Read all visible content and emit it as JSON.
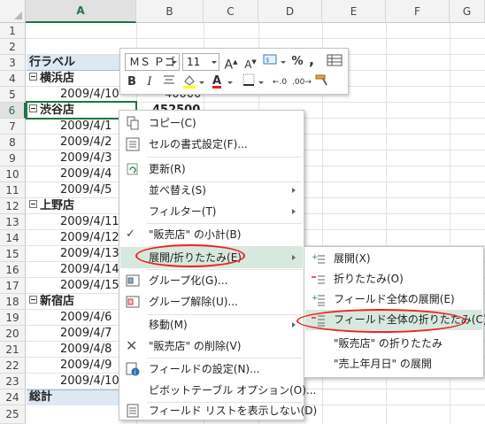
{
  "columns": [
    "A",
    "B",
    "C",
    "D",
    "E",
    "F",
    "G"
  ],
  "rows": [
    "1",
    "2",
    "3",
    "4",
    "5",
    "6",
    "7",
    "8",
    "9",
    "10",
    "11",
    "12",
    "13",
    "14",
    "15",
    "16",
    "17",
    "18",
    "19",
    "20",
    "21",
    "22",
    "23",
    "24",
    "25"
  ],
  "cells": {
    "r3": "行ラベル",
    "r4": "横浜店",
    "r5": "2009/4/10",
    "r5b": "40000",
    "r6": "渋谷店",
    "r6b": "452500",
    "r7": "2009/4/1",
    "r8": "2009/4/2",
    "r9": "2009/4/3",
    "r10": "2009/4/4",
    "r11": "2009/4/5",
    "r12": "上野店",
    "r13": "2009/4/11",
    "r14": "2009/4/12",
    "r15": "2009/4/13",
    "r16": "2009/4/14",
    "r17": "2009/4/15",
    "r18": "新宿店",
    "r19": "2009/4/6",
    "r20": "2009/4/7",
    "r21": "2009/4/8",
    "r22": "2009/4/9",
    "r23": "2009/4/10",
    "r24": "総計"
  },
  "minibar": {
    "font_name": "ＭＳ Ｐゴ",
    "font_size": "11",
    "bold": "B",
    "italic": "I",
    "percent": "%",
    "comma": ",",
    "font_color_letter": "A"
  },
  "context_menu": {
    "copy": "コピー(C)",
    "format_cells": "セルの書式設定(F)...",
    "refresh": "更新(R)",
    "sort": "並べ替え(S)",
    "filter": "フィルター(T)",
    "subtotal": "\"販売店\" の小計(B)",
    "expand_collapse": "展開/折りたたみ(E)",
    "group": "グループ化(G)...",
    "ungroup": "グループ解除(U)...",
    "move": "移動(M)",
    "delete": "\"販売店\" の削除(V)",
    "field_settings": "フィールドの設定(N)...",
    "pivot_options": "ピボットテーブル オプション(O)...",
    "hide_field_list": "フィールド リストを表示しない(D)"
  },
  "submenu": {
    "expand": "展開(X)",
    "collapse": "折りたたみ(O)",
    "expand_field": "フィールド全体の展開(E)",
    "collapse_field": "フィールド全体の折りたたみ(C)",
    "collapse_store": "\"販売店\" の折りたたみ",
    "expand_date": "\"売上年月日\" の展開"
  },
  "colors": {
    "accent": "#217346",
    "highlight": "#d7e8df",
    "pivot_header": "#dde8f3",
    "annotation_ring": "#e22222"
  }
}
